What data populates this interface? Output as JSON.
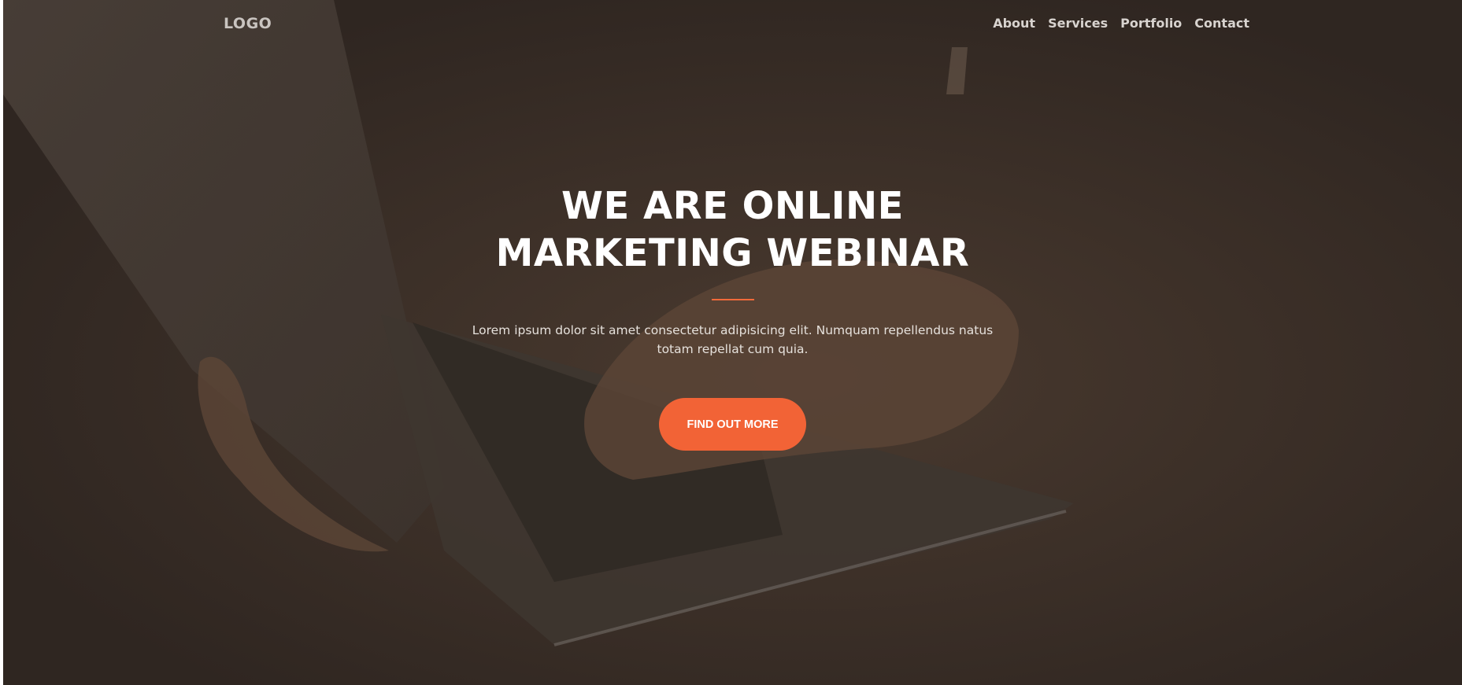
{
  "navbar": {
    "logo": "LOGO",
    "links": [
      "About",
      "Services",
      "Portfolio",
      "Contact"
    ]
  },
  "hero": {
    "title": "WE ARE ONLINE MARKETING WEBINAR",
    "text": "Lorem ipsum dolor sit amet consectetur adipisicing elit. Numquam repellendus natus totam repellat cum quia.",
    "cta_label": "FIND OUT MORE"
  },
  "colors": {
    "accent": "#f26336",
    "overlay": "#3a2e27",
    "text_light": "#ffffff"
  }
}
